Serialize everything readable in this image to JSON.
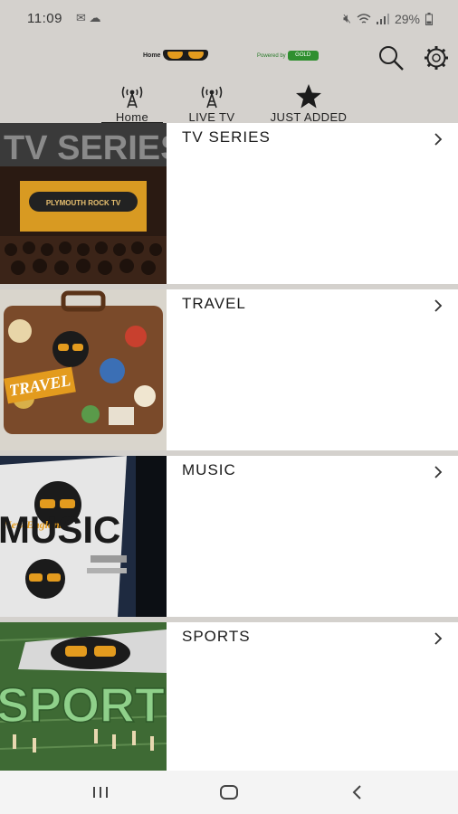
{
  "status": {
    "time": "11:09",
    "battery": "29%",
    "icons": [
      "gmail-icon",
      "cloud-icon",
      "mute-icon",
      "wifi-icon",
      "signal-icon",
      "battery-icon"
    ]
  },
  "header": {
    "logo_text": "Home",
    "sponsor_text": "Powered by",
    "sponsor_badge": "GOLD",
    "search_icon": "search-icon",
    "settings_icon": "gear-icon"
  },
  "tabs": [
    {
      "label": "Home",
      "icon": "antenna-icon",
      "active": true
    },
    {
      "label": "LIVE TV",
      "icon": "antenna-icon",
      "active": false
    },
    {
      "label": "JUST ADDED",
      "icon": "star-icon",
      "active": false
    }
  ],
  "categories": [
    {
      "title": "TV SERIES",
      "thumb_text": "TV SERIES",
      "sign_text": "PLYMOUTH ROCK TV"
    },
    {
      "title": "TRAVEL",
      "thumb_text": "TRAVEL"
    },
    {
      "title": "MUSIC",
      "thumb_text": "MUSIC",
      "sub_text": "New England"
    },
    {
      "title": "SPORTS",
      "thumb_text": "SPORTS"
    }
  ],
  "colors": {
    "background": "#d4d1cd",
    "accent": "#e39b1e",
    "row_bg": "#ffffff"
  }
}
